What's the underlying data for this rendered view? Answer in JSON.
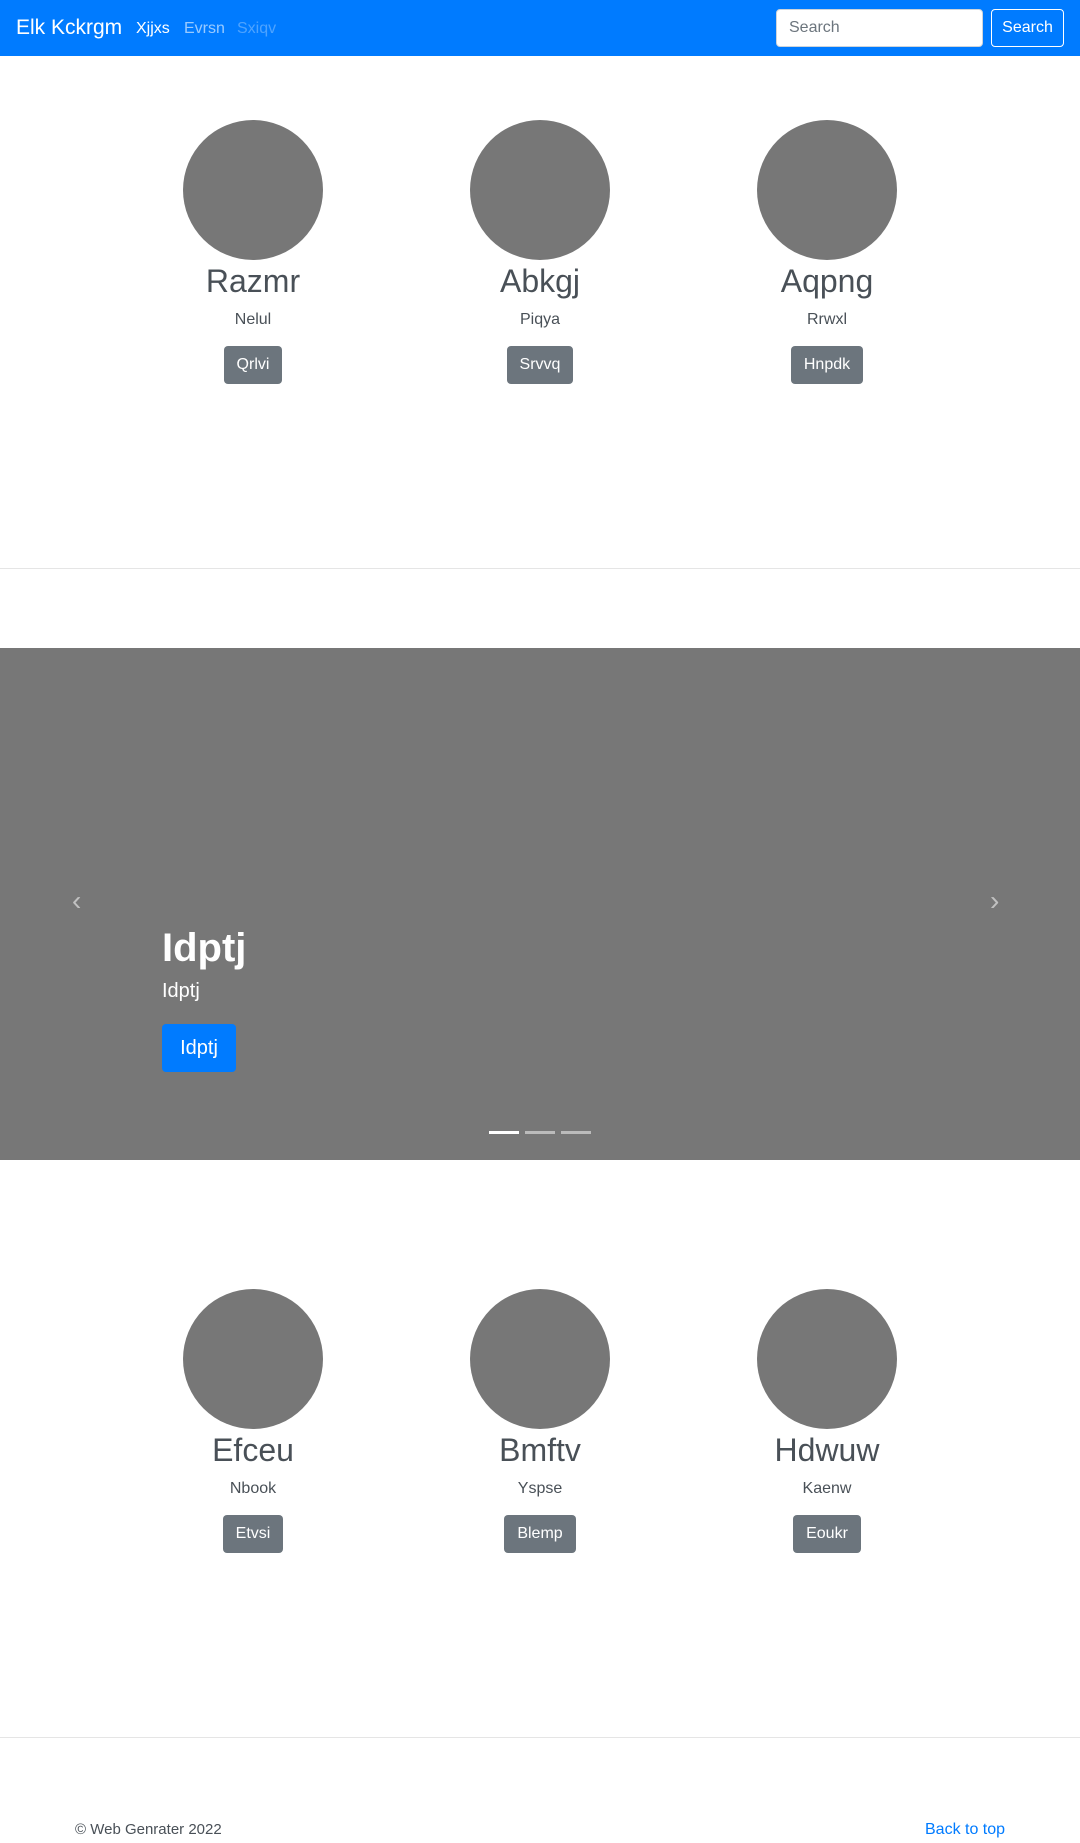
{
  "navbar": {
    "brand": "Elk Kckrgm",
    "links": [
      "Xjjxs",
      "Evrsn",
      "Sxiqv"
    ],
    "search_placeholder": "Search",
    "search_button": "Search",
    "color": "#007bff"
  },
  "top_columns": [
    {
      "title": "Razmr",
      "subtitle": "Nelul",
      "button": "Qrlvi"
    },
    {
      "title": "Abkgj",
      "subtitle": "Piqya",
      "button": "Srvvq"
    },
    {
      "title": "Aqpng",
      "subtitle": "Rrwxl",
      "button": "Hnpdk"
    }
  ],
  "carousel": {
    "title": "Idptj",
    "subtitle": "Idptj",
    "button": "Idptj",
    "prev_icon": "‹",
    "next_icon": "›",
    "active_slide": 1,
    "slide_count": 3
  },
  "bottom_columns": [
    {
      "title": "Efceu",
      "subtitle": "Nbook",
      "button": "Etvsi"
    },
    {
      "title": "Bmftv",
      "subtitle": "Yspse",
      "button": "Blemp"
    },
    {
      "title": "Hdwuw",
      "subtitle": "Kaenw",
      "button": "Eoukr"
    }
  ],
  "footer": {
    "copyright": "© Web Genrater 2022",
    "back_to_top": "Back to top"
  }
}
